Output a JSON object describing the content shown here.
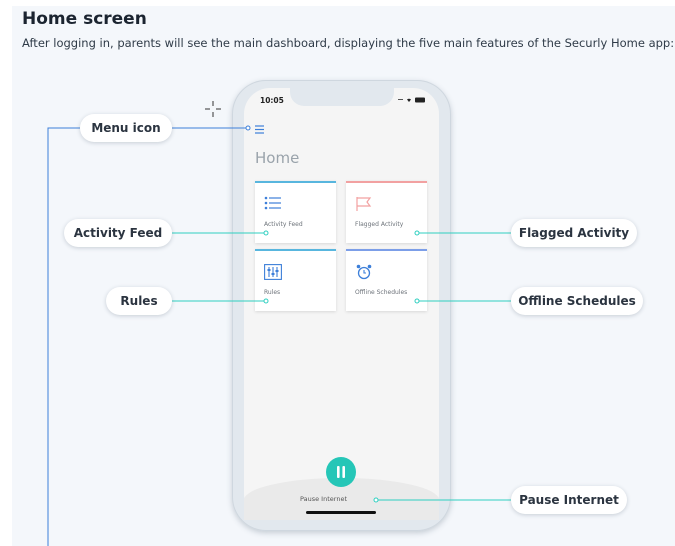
{
  "heading": {
    "title": "Home screen",
    "subtitle": "After logging in, parents will see the main dashboard, displaying the five main features of the Securly Home app:"
  },
  "phone": {
    "status_time": "10:05",
    "screen_title": "Home",
    "cards": [
      {
        "label": "Activity Feed",
        "icon": "list-icon"
      },
      {
        "label": "Flagged Activity",
        "icon": "flag-icon"
      },
      {
        "label": "Rules",
        "icon": "sliders-icon"
      },
      {
        "label": "Offline Schedules",
        "icon": "alarm-clock-icon"
      }
    ],
    "pause_label": "Pause Internet"
  },
  "callouts": {
    "menu_icon": "Menu icon",
    "activity_feed": "Activity Feed",
    "rules": "Rules",
    "flagged_activity": "Flagged Activity",
    "offline_schedules": "Offline Schedules",
    "pause_internet": "Pause Internet"
  },
  "colors": {
    "accent_teal": "#25c6b7",
    "connector_line": "#2fcfc0",
    "menu_line": "#3d7fd9",
    "flag_accent": "#f2a1a1",
    "offline_accent": "#7c9ee8",
    "activity_accent": "#58b6de"
  }
}
